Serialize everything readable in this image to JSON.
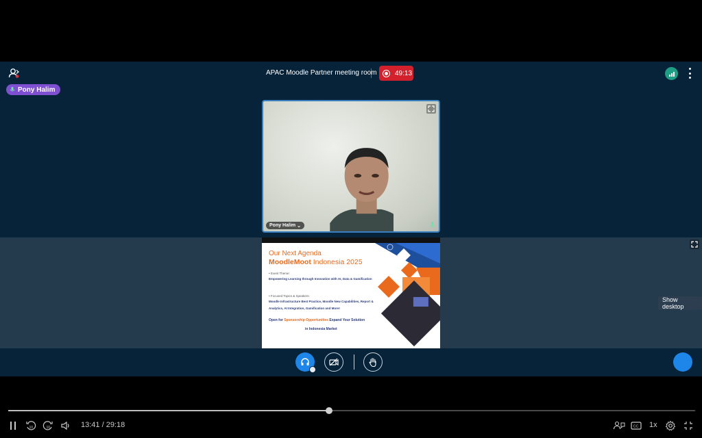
{
  "meeting": {
    "room_title": "APAC Moodle Partner meeting room",
    "recording_time": "49:13",
    "talker": "Pony Halim",
    "webcam_user": "Pony Halim"
  },
  "slide": {
    "title_line1": "Our Next Agenda",
    "title_bold": "MoodleMoot",
    "title_rest": " Indonesia 2025",
    "event_theme_label": "• Event Theme:",
    "event_theme": "Empowering Learning through Innovation with AI, Data & Gamification",
    "topics_label": "• Focused Topics & Speakers:",
    "topics": "Moodle Infrastructure Best Practice, Moodle New Capabilities, Report & Analytics, AI Integration, Gamification and More!",
    "open_prefix": "Open for ",
    "open_highlight": "Sponsorship Opportunities",
    "open_suffix": " Expand Your Solution",
    "open_line2": "in Indonesia Market"
  },
  "tooltip": "Show desktop",
  "playback": {
    "current_time": "13:41",
    "duration": "29:18",
    "time_display": "13:41 / 29:18",
    "progress": 0.467,
    "speed": "1x"
  },
  "colors": {
    "stage_bg": "#06233a",
    "band_bg": "#243b4e",
    "record_red": "#d2202c",
    "talker_purple": "#7e4fd1",
    "accent_blue": "#1d86e8",
    "slide_orange": "#e96a1d",
    "slide_navy": "#2a3a7a"
  },
  "icons": [
    "users-icon",
    "microphone-icon",
    "record-icon",
    "connection-status-icon",
    "more-options-icon",
    "fullscreen-icon",
    "headphones-icon",
    "camera-off-icon",
    "raise-hand-icon",
    "pause-icon",
    "rewind-10-icon",
    "forward-10-icon",
    "volume-icon",
    "chat-icon",
    "captions-icon",
    "settings-icon",
    "fullscreen-exit-icon"
  ]
}
